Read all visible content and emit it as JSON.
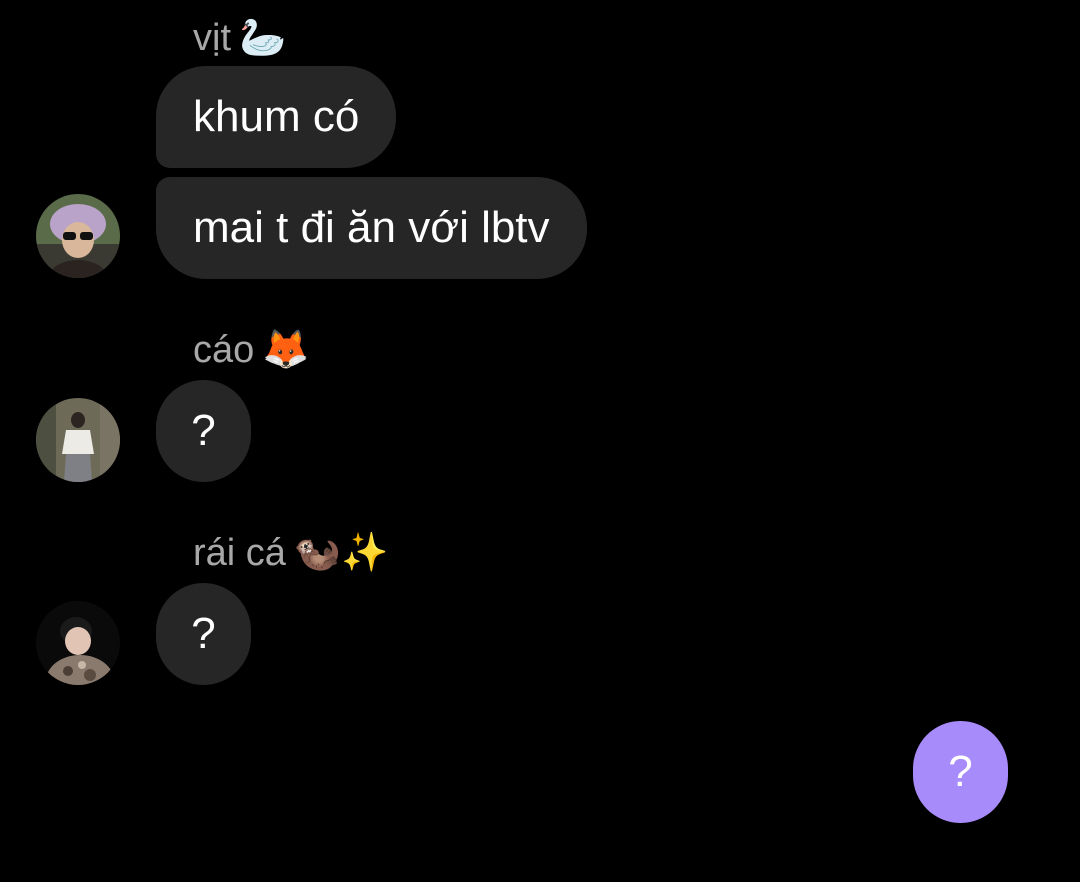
{
  "messages": [
    {
      "sender": "vịt",
      "sender_emoji": "🦢",
      "bubbles": [
        "khum có",
        "mai t đi ăn với lbtv"
      ]
    },
    {
      "sender": "cáo",
      "sender_emoji": "🦊",
      "bubbles": [
        "?"
      ]
    },
    {
      "sender": "rái cá",
      "sender_emoji": "🦦✨",
      "bubbles": [
        "?"
      ]
    }
  ],
  "my_message": "?",
  "colors": {
    "background": "#000000",
    "incoming_bubble": "#262626",
    "outgoing_bubble": "#a78bfa",
    "sender_name": "#a8a8a8"
  }
}
